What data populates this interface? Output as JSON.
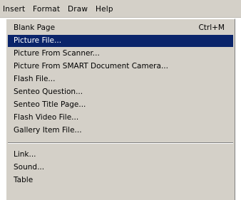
{
  "menubar": {
    "items": [
      "Insert",
      "Format",
      "Draw",
      "Help"
    ]
  },
  "menu": {
    "items": [
      {
        "label": "Blank Page",
        "shortcut": "Ctrl+M"
      },
      {
        "label": "Picture File..."
      },
      {
        "label": "Picture From Scanner..."
      },
      {
        "label": "Picture From SMART Document Camera..."
      },
      {
        "label": "Flash File..."
      },
      {
        "label": "Senteo Question..."
      },
      {
        "label": "Senteo Title Page..."
      },
      {
        "label": "Flash Video File..."
      },
      {
        "label": "Gallery Item File..."
      },
      {
        "label": "Link..."
      },
      {
        "label": "Sound..."
      },
      {
        "label": "Table"
      }
    ],
    "selected_label": "Picture File..."
  },
  "colors": {
    "menu_background": "#d4d0c8",
    "selection_background": "#0a246a",
    "selection_text": "#ffffff"
  }
}
